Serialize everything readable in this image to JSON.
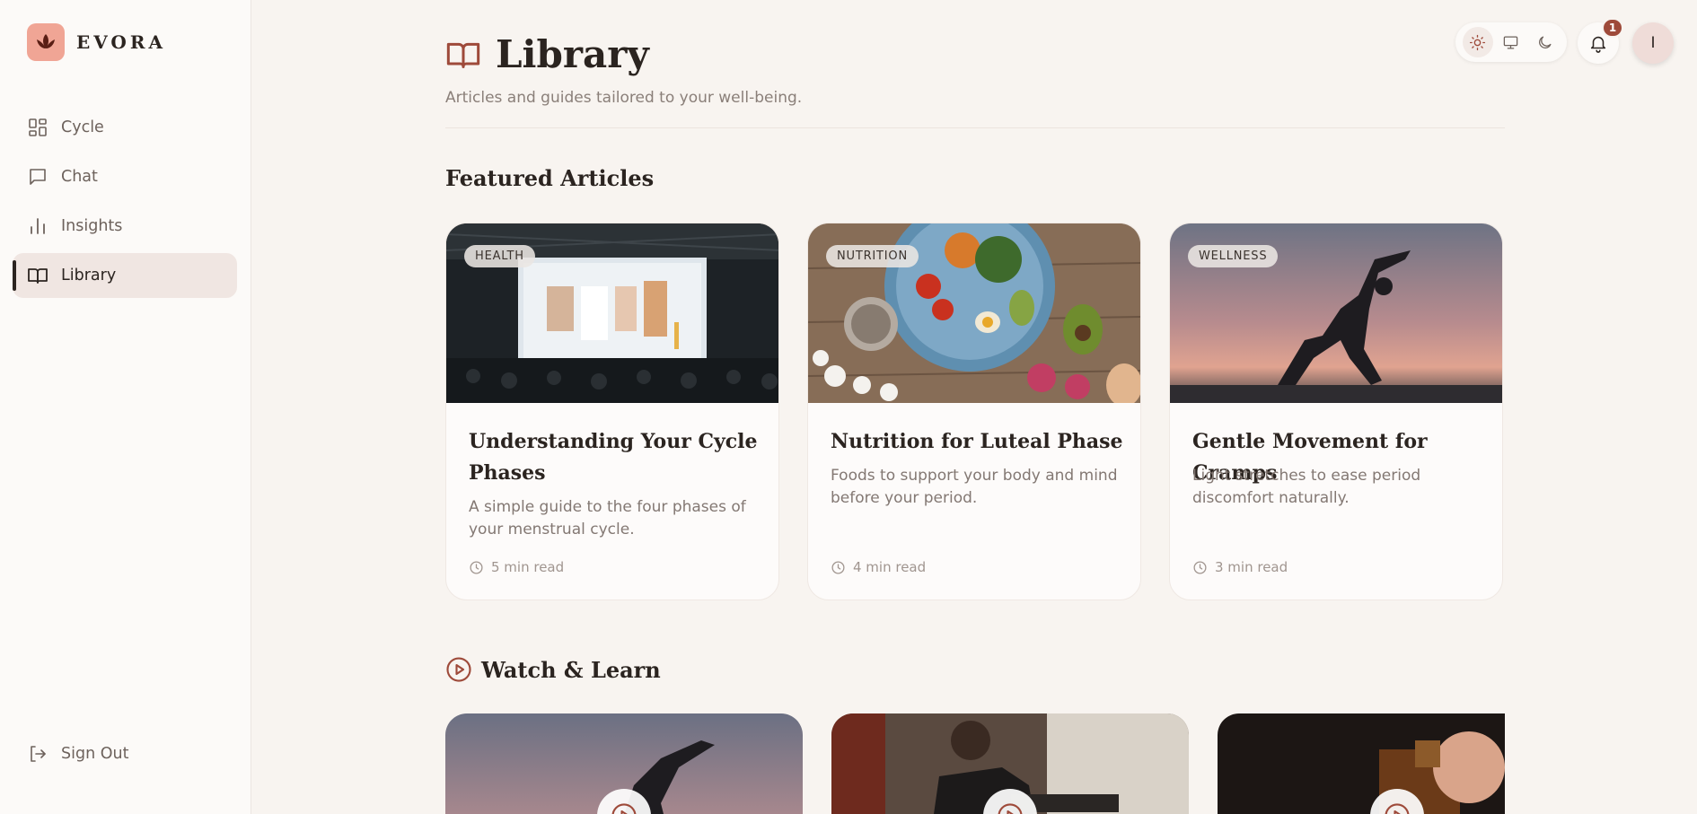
{
  "app": {
    "brand": "EVORA"
  },
  "sidebar": {
    "items": [
      {
        "label": "Cycle",
        "icon": "grid-icon",
        "active": false
      },
      {
        "label": "Chat",
        "icon": "chat-icon",
        "active": false
      },
      {
        "label": "Insights",
        "icon": "bar-chart-icon",
        "active": false
      },
      {
        "label": "Library",
        "icon": "book-icon",
        "active": true
      }
    ],
    "signout_label": "Sign Out"
  },
  "topbar": {
    "theme_options": [
      "light",
      "system",
      "dark"
    ],
    "theme_selected": "light",
    "notifications_count": "1",
    "avatar_initial": "I"
  },
  "header": {
    "title": "Library",
    "subtitle": "Articles and guides tailored to your well-being."
  },
  "featured": {
    "title": "Featured Articles",
    "articles": [
      {
        "tag": "HEALTH",
        "title": "Understanding Your Cycle Phases",
        "description": "A simple guide to the four phases of your menstrual cycle.",
        "read_time": "5 min read"
      },
      {
        "tag": "NUTRITION",
        "title": "Nutrition for Luteal Phase",
        "description": "Foods to support your body and mind before your period.",
        "read_time": "4 min read"
      },
      {
        "tag": "WELLNESS",
        "title": "Gentle Movement for Cramps",
        "description": "Light stretches to ease period discomfort naturally.",
        "read_time": "3 min read"
      }
    ]
  },
  "watch": {
    "title": "Watch & Learn"
  },
  "colors": {
    "accent": "#9e4a3a",
    "background": "#f8f4f0",
    "active_nav": "#f0e6e2",
    "logo": "#f0a595"
  }
}
